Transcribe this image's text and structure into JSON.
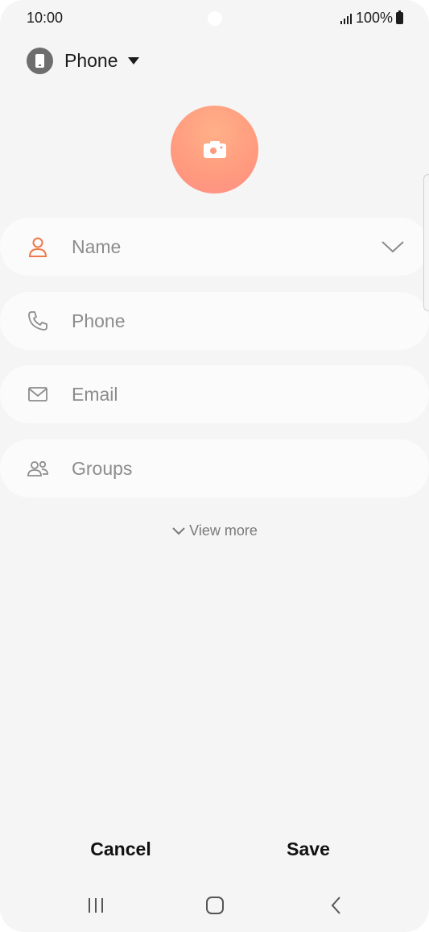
{
  "status_bar": {
    "time": "10:00",
    "battery_text": "100%"
  },
  "account": {
    "label": "Phone"
  },
  "fields": {
    "name_placeholder": "Name",
    "phone_placeholder": "Phone",
    "email_placeholder": "Email",
    "groups_placeholder": "Groups"
  },
  "view_more": {
    "label": "View more"
  },
  "actions": {
    "cancel_label": "Cancel",
    "save_label": "Save"
  },
  "icons": {
    "account": "phone-device-icon",
    "photo": "camera-icon",
    "name": "person-icon",
    "phone": "phone-handset-icon",
    "email": "envelope-icon",
    "groups": "people-icon"
  },
  "colors": {
    "accent": "#ff8f6e",
    "background": "#f5f5f5",
    "field_bg": "#fbfbfb",
    "placeholder": "#8c8c8c"
  }
}
